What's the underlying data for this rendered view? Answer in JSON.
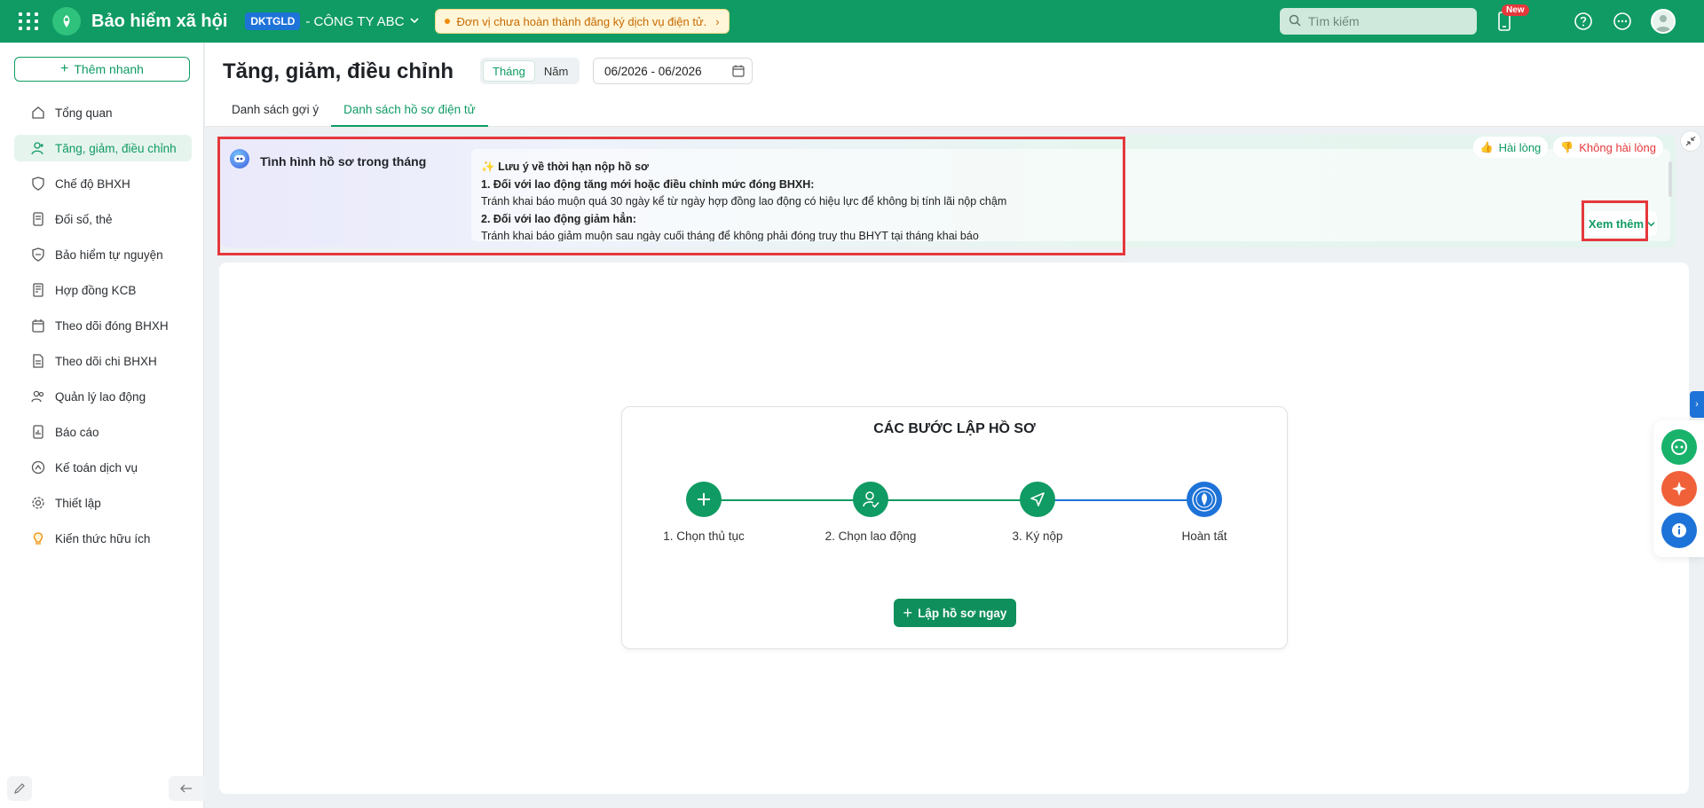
{
  "topbar": {
    "app_title": "Bảo hiểm xã hội",
    "company_code": "DKTGLD",
    "company_name": "- CÔNG TY ABC",
    "notice": "Đơn vị chưa hoàn thành đăng ký dịch vụ điện tử.",
    "search_placeholder": "Tìm kiếm",
    "new_badge": "New",
    "icons": [
      "apps-grid-icon",
      "phone-icon",
      "help-icon",
      "more-icon"
    ]
  },
  "sidebar": {
    "quick_add": "Thêm nhanh",
    "items": [
      {
        "label": "Tổng quan",
        "icon": "home-icon"
      },
      {
        "label": "Tăng, giảm, điều chỉnh",
        "icon": "user-adjust-icon"
      },
      {
        "label": "Chế độ BHXH",
        "icon": "shield-heart-icon"
      },
      {
        "label": "Đối số, thẻ",
        "icon": "card-icon"
      },
      {
        "label": "Bảo hiểm tự nguyện",
        "icon": "shield-icon"
      },
      {
        "label": "Hợp đồng KCB",
        "icon": "contract-icon"
      },
      {
        "label": "Theo dõi đóng BHXH",
        "icon": "calendar-track-icon"
      },
      {
        "label": "Theo dõi chi BHXH",
        "icon": "document-track-icon"
      },
      {
        "label": "Quản lý lao động",
        "icon": "users-icon"
      },
      {
        "label": "Báo cáo",
        "icon": "report-icon"
      },
      {
        "label": "Kế toán dịch vụ",
        "icon": "accounting-icon"
      },
      {
        "label": "Thiết lập",
        "icon": "gear-icon"
      },
      {
        "label": "Kiến thức hữu ích",
        "icon": "lightbulb-icon"
      }
    ],
    "active_index": 1
  },
  "header": {
    "title": "Tăng, giảm, điều chỉnh",
    "period_options": [
      "Tháng",
      "Năm"
    ],
    "period_selected": "Tháng",
    "date_range": "06/2026 - 06/2026",
    "tabs": [
      "Danh sách gợi ý",
      "Danh sách hồ sơ điện tử"
    ],
    "active_tab": 1
  },
  "banner": {
    "title": "Tình hình hồ sơ trong tháng",
    "like": "Hài lòng",
    "dislike": "Không hài lòng",
    "note_heading": "Lưu ý về thời hạn nộp hồ sơ",
    "note_lines": [
      {
        "text": "1. Đối với lao động tăng mới hoặc điều chỉnh mức đóng BHXH:",
        "bold": true
      },
      {
        "text": "Tránh khai báo muộn quá 30 ngày kể từ ngày hợp đồng lao động có hiệu lực để không bị tính lãi nộp chậm",
        "bold": false
      },
      {
        "text": "2. Đối với lao động giảm hẳn:",
        "bold": true
      },
      {
        "text": "Tránh khai báo giảm muộn sau ngày cuối tháng để không phải đóng truy thu BHYT tại tháng khai báo",
        "bold": false
      }
    ],
    "see_more": "Xem thêm"
  },
  "steps": {
    "title": "CÁC BƯỚC LẬP HỒ SƠ",
    "items": [
      {
        "label": "1. Chọn thủ tục",
        "icon": "plus-icon"
      },
      {
        "label": "2. Chọn lao động",
        "icon": "user-check-icon"
      },
      {
        "label": "3. Ký nộp",
        "icon": "send-icon"
      },
      {
        "label": "Hoàn tất",
        "icon": "vss-emblem-icon"
      }
    ],
    "cta": "Lập hồ sơ ngay"
  },
  "colors": {
    "brand": "#0f9b63",
    "accent_blue": "#1e73d8",
    "highlight": "#e5383b"
  }
}
